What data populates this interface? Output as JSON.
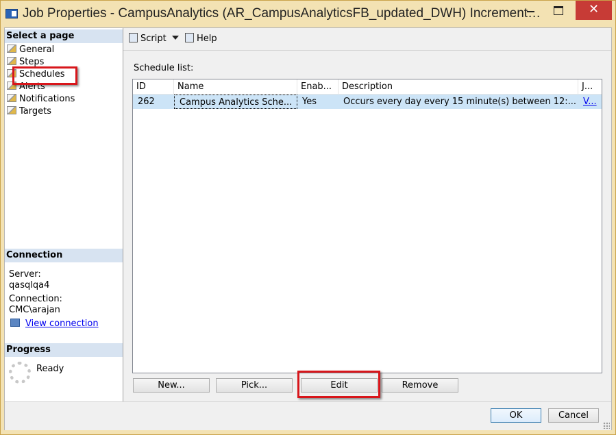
{
  "window": {
    "title": "Job Properties - CampusAnalytics (AR_CampusAnalyticsFB_updated_DWH) Increment…",
    "close_glyph": "✕"
  },
  "left_pane": {
    "select_header": "Select a page",
    "pages": [
      {
        "label": "General",
        "icon": "page-icon"
      },
      {
        "label": "Steps",
        "icon": "page-icon"
      },
      {
        "label": "Schedules",
        "icon": "page-icon"
      },
      {
        "label": "Alerts",
        "icon": "page-icon"
      },
      {
        "label": "Notifications",
        "icon": "page-icon"
      },
      {
        "label": "Targets",
        "icon": "page-icon"
      }
    ],
    "connection": {
      "header": "Connection",
      "server_label": "Server:",
      "server_value": "qasqlqa4",
      "connection_label": "Connection:",
      "connection_value": "CMC\\arajan",
      "view_connection": "View connection"
    },
    "progress": {
      "header": "Progress",
      "status": "Ready"
    }
  },
  "toolbar": {
    "script_label": "Script",
    "help_label": "Help"
  },
  "schedules": {
    "list_label": "Schedule list:",
    "columns": [
      "ID",
      "Name",
      "Enab...",
      "Description",
      "J..."
    ],
    "rows": [
      {
        "id": "262",
        "name": "Campus Analytics Sche...",
        "enabled": "Yes",
        "description": "Occurs every day every 15 minute(s) between 12:...",
        "jobs": "V..."
      }
    ],
    "buttons": {
      "new": "New...",
      "pick": "Pick...",
      "edit": "Edit",
      "remove": "Remove"
    }
  },
  "dialog_buttons": {
    "ok": "OK",
    "cancel": "Cancel"
  },
  "colors": {
    "highlight": "#d8161b",
    "selected_row": "#cce4f7",
    "section_header": "#d7e3f1",
    "close_button": "#c73b36"
  }
}
